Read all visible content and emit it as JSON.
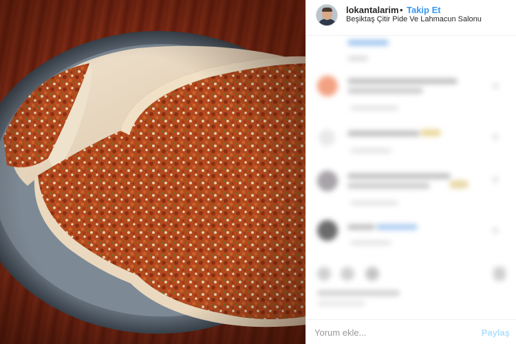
{
  "post": {
    "username": "lokantalarim",
    "separator": "•",
    "follow_label": "Takip Et",
    "location": "Beşiktaş Çitir Pide Ve Lahmacun Salonu"
  },
  "comment_box": {
    "placeholder": "Yorum ekle...",
    "share_label": "Paylaş"
  },
  "colors": {
    "accent": "#3897f0",
    "share_disabled": "#b2dffc",
    "border": "#efefef"
  },
  "icons": [
    "avatar",
    "plate-photo"
  ]
}
